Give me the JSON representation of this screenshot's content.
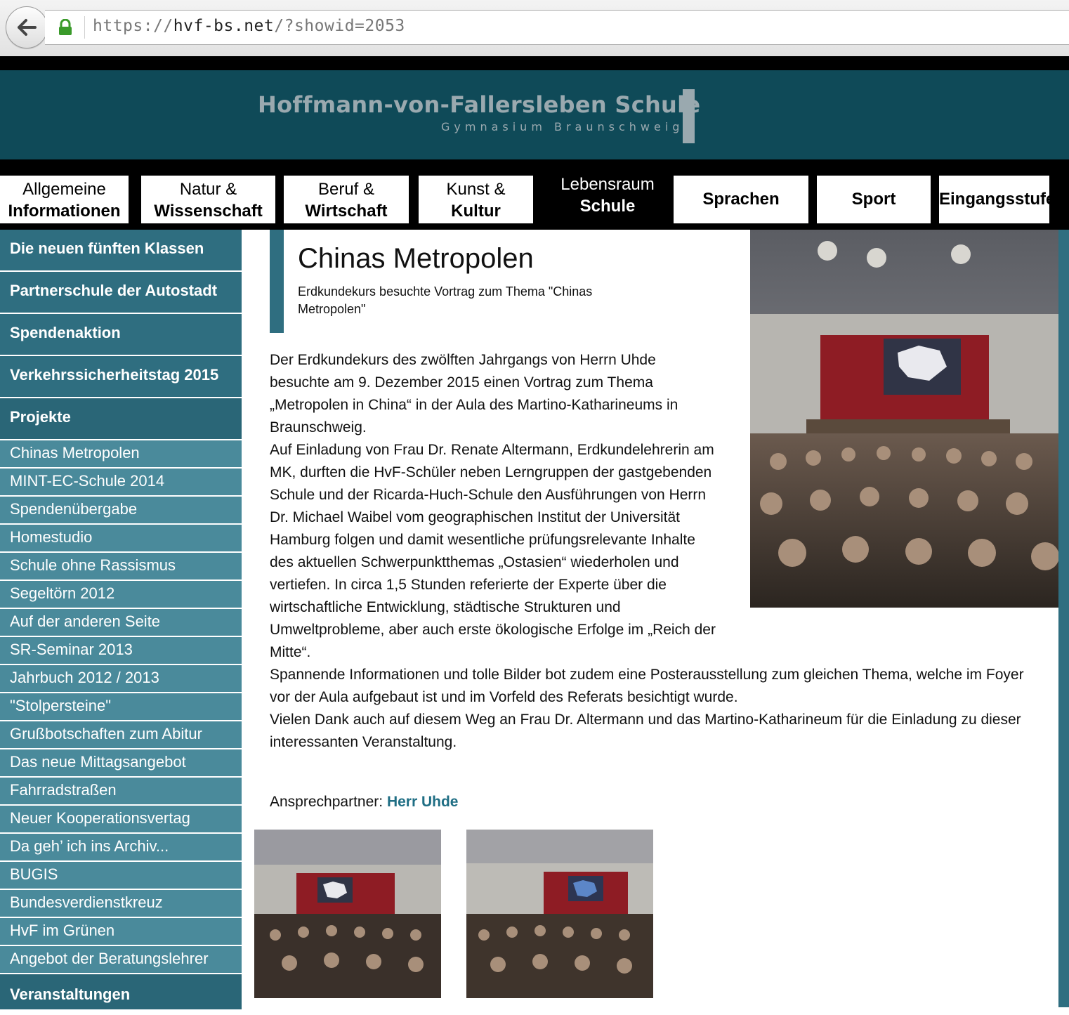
{
  "browser": {
    "url_scheme": "https://",
    "url_host": "hvf-bs.net",
    "url_path": "/?showid=2053"
  },
  "header": {
    "school_name": "Hoffmann-von-Fallersleben Schule",
    "school_type": "Gymnasium Braunschweig"
  },
  "nav": [
    {
      "line1": "Allgemeine",
      "line2": "Informationen"
    },
    {
      "line1": "Natur &",
      "line2": "Wissenschaft"
    },
    {
      "line1": "Beruf &",
      "line2": "Wirtschaft"
    },
    {
      "line1": "Kunst &",
      "line2": "Kultur"
    },
    {
      "line1": "Lebensraum",
      "line2": "Schule",
      "active": true
    },
    {
      "line1": "",
      "line2": "Sprachen"
    },
    {
      "line1": "",
      "line2": "Sport"
    },
    {
      "line1": "",
      "line2": "Eingangsstufe"
    }
  ],
  "sidebar": {
    "top": [
      "Die neuen fünften Klassen",
      "Partnerschule der Autostadt",
      "Spendenaktion",
      "Verkehrssicherheitstag 2015",
      "Projekte"
    ],
    "projects": [
      "Chinas Metropolen",
      "MINT-EC-Schule 2014",
      "Spendenübergabe",
      "Homestudio",
      "Schule ohne Rassismus",
      "Segeltörn 2012",
      "Auf der anderen Seite",
      "SR-Seminar 2013",
      "Jahrbuch 2012 / 2013",
      "\"Stolpersteine\"",
      "Grußbotschaften zum Abitur",
      "Das neue Mittagsangebot",
      "Fahrradstraßen",
      "Neuer Kooperationsvertag",
      "Da geh’ ich ins Archiv...",
      "BUGIS",
      "Bundesverdienstkreuz",
      "HvF im Grünen",
      "Angebot der Beratungslehrer"
    ],
    "bottom": "Veranstaltungen"
  },
  "article": {
    "title": "Chinas Metropolen",
    "subtitle": "Erdkundekurs besuchte Vortrag zum Thema \"Chinas Metropolen\"",
    "paragraphs": [
      "Der Erdkundekurs des zwölften Jahrgangs von Herrn Uhde besuchte am 9. Dezember 2015 einen Vortrag zum Thema „Metropolen in China“ in der Aula des Martino-Katharineums in Braunschweig.",
      "Auf Einladung von Frau Dr. Renate Altermann, Erdkundelehrerin am MK, durften die HvF-Schüler neben Lerngruppen der gastgebenden Schule und der Ricarda-Huch-Schule den Ausführungen von Herrn Dr. Michael Waibel vom geographischen Institut der Universität Hamburg folgen und damit wesentliche prüfungsrelevante Inhalte des aktuellen Schwerpunktthemas „Ostasien“ wiederholen und vertiefen. In circa 1,5 Stunden referierte der Experte über die wirtschaftliche Entwicklung, städtische Strukturen und Umweltprobleme, aber auch erste ökologische Erfolge im „Reich der Mitte“.",
      "Spannende Informationen und tolle Bilder bot zudem eine Posterausstellung zum gleichen Thema, welche im Foyer vor der Aula aufgebaut ist und im Vorfeld des Referats besichtigt wurde.",
      "Vielen Dank auch auf diesem Weg an Frau Dr. Altermann und das Martino-Katharineum für die Einladung zu dieser interessanten Veranstaltung."
    ],
    "contact_label": "Ansprechpartner:",
    "contact_name": "Herr Uhde"
  },
  "colors": {
    "banner": "#0f4a58",
    "sidebar": "#3b7a8c",
    "link": "#1f6e84"
  }
}
